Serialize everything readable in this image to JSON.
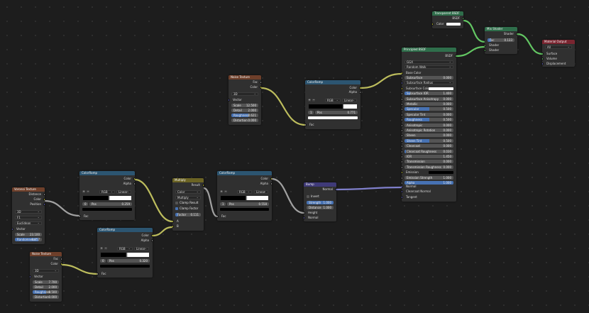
{
  "app": {
    "title": "",
    "view": "Shader Editor"
  },
  "colors": {
    "header_texture": "#6e3f2a",
    "header_converter": "#2c5571",
    "header_vector": "#3f3a78",
    "header_shader": "#2f6e4b",
    "header_output": "#7a2530",
    "header_colorop": "#6b6324",
    "socket_float": "#a1a1a1",
    "socket_color": "#c7c729",
    "socket_shader": "#63c763",
    "socket_vector": "#6363c7",
    "wire_color": "#bdbd5d",
    "wire_shader": "#63c763",
    "wire_vector": "#8080cc"
  },
  "nodes": {
    "noise1": {
      "title": "Noise Texture",
      "out_fac": "Fac",
      "out_color": "Color",
      "dim": "3D",
      "in_vector": "Vector",
      "scale_k": "Scale",
      "scale_v": "12.500",
      "detail_k": "Detail",
      "detail_v": "2.000",
      "rough_k": "Roughness",
      "rough_v": "0.621",
      "dist_k": "Distortion",
      "dist_v": "0.000"
    },
    "ramp_top": {
      "title": "ColorRamp",
      "out_color": "Color",
      "out_alpha": "Alpha",
      "mode": "RGB",
      "interp": "Linear",
      "index": "1",
      "pos_k": "Pos",
      "pos_v": "0.771",
      "in_fac": "Fac"
    },
    "transparent": {
      "title": "Transparent BSDF",
      "out": "BSDF",
      "color": "Color"
    },
    "mix": {
      "title": "Mix Shader",
      "out": "Shader",
      "fac_k": "Fac",
      "fac_v": "0.133",
      "in1": "Shader",
      "in2": "Shader"
    },
    "output": {
      "title": "Material Output",
      "target": "All",
      "surface": "Surface",
      "volume": "Volume",
      "disp": "Displacement"
    },
    "principled": {
      "title": "Principled BSDF",
      "out": "BSDF",
      "dist": "GGX",
      "sss": "Random Walk",
      "base": "Base Color",
      "rows": [
        {
          "k": "Subsurface",
          "v": "0.000",
          "fill": 0
        },
        {
          "k": "Subsurface Radius",
          "v": "",
          "fill": 0,
          "dd": true
        },
        {
          "k": "Subsurface Color",
          "v": "",
          "fill": 0,
          "color": true
        },
        {
          "k": "Subsurface IOR",
          "v": "1.400",
          "fill": 0.12
        },
        {
          "k": "Subsurface Anisotropy",
          "v": "0.000",
          "fill": 0
        },
        {
          "k": "Metallic",
          "v": "0.000",
          "fill": 0
        },
        {
          "k": "Specular",
          "v": "0.500",
          "fill": 0.5
        },
        {
          "k": "Specular Tint",
          "v": "0.000",
          "fill": 0
        },
        {
          "k": "Roughness",
          "v": "0.500",
          "fill": 0.5
        },
        {
          "k": "Anisotropic",
          "v": "0.000",
          "fill": 0
        },
        {
          "k": "Anisotropic Rotation",
          "v": "0.000",
          "fill": 0
        },
        {
          "k": "Sheen",
          "v": "0.000",
          "fill": 0
        },
        {
          "k": "Sheen Tint",
          "v": "0.500",
          "fill": 0.5
        },
        {
          "k": "Clearcoat",
          "v": "0.000",
          "fill": 0
        },
        {
          "k": "Clearcoat Roughness",
          "v": "0.030",
          "fill": 0.03
        },
        {
          "k": "IOR",
          "v": "1.450",
          "fill": 0
        },
        {
          "k": "Transmission",
          "v": "0.000",
          "fill": 0
        },
        {
          "k": "Transmission Roughness",
          "v": "0.000",
          "fill": 0
        },
        {
          "k": "Emission",
          "v": "",
          "fill": 0,
          "emission": true
        },
        {
          "k": "Emission Strength",
          "v": "1.000",
          "fill": 0
        },
        {
          "k": "Alpha",
          "v": "1.000",
          "fill": 1
        }
      ],
      "normal": "Normal",
      "cc_normal": "Clearcoat Normal",
      "tangent": "Tangent"
    },
    "bump": {
      "title": "Bump",
      "out": "Normal",
      "invert": "Invert",
      "str_k": "Strength",
      "str_v": "1.000",
      "dist_k": "Distance",
      "dist_v": "1.000",
      "height": "Height",
      "normal": "Normal"
    },
    "ramp_mid": {
      "title": "ColorRamp",
      "out_color": "Color",
      "out_alpha": "Alpha",
      "mode": "RGB",
      "interp": "Linear",
      "index": "1",
      "pos_k": "Pos",
      "pos_v": "0.558",
      "in_fac": "Fac"
    },
    "multiply": {
      "title": "Multiply",
      "out": "Result",
      "type": "Color",
      "blend": "Multiply",
      "clamp_result": "Clamp Result",
      "clamp_factor": "Clamp Factor",
      "fac_k": "Factor",
      "fac_v": "0.111",
      "a": "A",
      "b": "B"
    },
    "ramp_left": {
      "title": "ColorRamp",
      "out_color": "Color",
      "out_alpha": "Alpha",
      "mode": "RGB",
      "interp": "Linear",
      "index": "0",
      "pos_k": "Pos",
      "pos_v": "0.259",
      "in_fac": "Fac"
    },
    "ramp_low": {
      "title": "ColorRamp",
      "out_color": "Color",
      "out_alpha": "Alpha",
      "mode": "RGB",
      "interp": "Linear",
      "index": "0",
      "pos_k": "Pos",
      "pos_v": "0.320",
      "in_fac": "Fac"
    },
    "voronoi": {
      "title": "Voronoi Texture",
      "out_dist": "Distance",
      "out_color": "Color",
      "out_pos": "Position",
      "dim": "3D",
      "feature": "F1",
      "metric": "Euclidean",
      "in_vector": "Vector",
      "scale_k": "Scale",
      "scale_v": "23.100",
      "rand_k": "Randomness",
      "rand_v": "0.857"
    },
    "noise2": {
      "title": "Noise Texture",
      "out_fac": "Fac",
      "out_color": "Color",
      "dim": "3D",
      "in_vector": "Vector",
      "scale_k": "Scale",
      "scale_v": "7.700",
      "detail_k": "Detail",
      "detail_v": "2.000",
      "rough_k": "Roughness",
      "rough_v": "0.500",
      "dist_k": "Distortion",
      "dist_v": "0.000"
    }
  }
}
